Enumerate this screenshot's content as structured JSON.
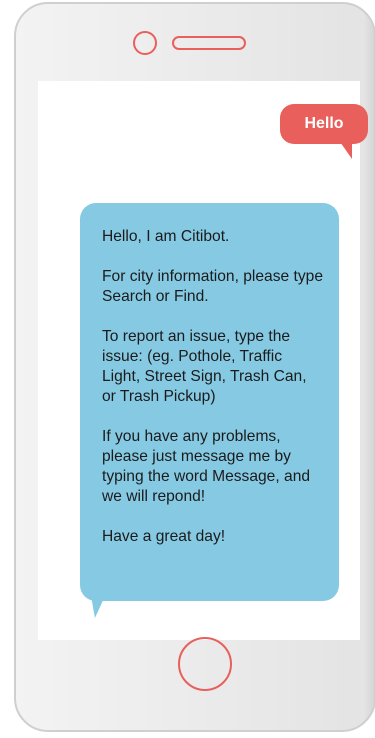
{
  "colors": {
    "accent_coral": "#e85f5c",
    "bot_bubble_blue": "#86c9e3",
    "phone_gray": "#ececec",
    "screen_white": "#ffffff"
  },
  "icons": {
    "camera": "camera-icon",
    "speaker": "speaker-icon",
    "home": "home-button"
  },
  "chat": {
    "user_message": "Hello",
    "bot_message": {
      "line1": "Hello, I am Citibot.",
      "line2": "For city information, please type Search or Find.",
      "line3": "To report an issue, type the issue: (eg. Pothole, Traffic Light, Street Sign, Trash Can, or Trash Pickup)",
      "line4": "If you have any problems, please just message me by typing the word Message, and we will repond!",
      "line5": "Have a great day!"
    }
  }
}
